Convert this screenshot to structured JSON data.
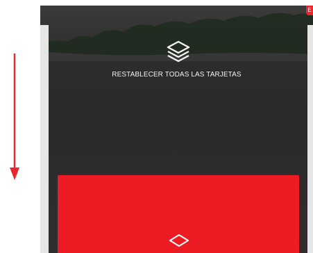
{
  "scroll_hint": {
    "direction": "down",
    "color": "#e8262b",
    "icon": "arrow-down-icon"
  },
  "reset_button": {
    "label": "RESTABLECER TODAS LAS TARJETAS",
    "icon": "stack-layers-icon"
  },
  "corner_badge": {
    "label": "E"
  },
  "card": {
    "color": "#ed1c24",
    "icon": "diamond-outline-icon"
  }
}
